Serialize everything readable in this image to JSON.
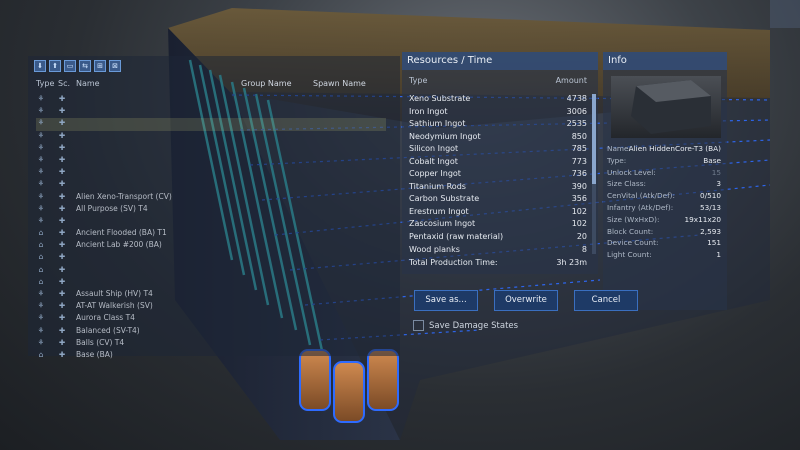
{
  "left_panel": {
    "toolbar": [
      "⬇",
      "⬆",
      "▭",
      "⇆",
      "⊞",
      "⊠"
    ],
    "headers": {
      "type": "Type",
      "sc": "Sc.",
      "name": "Name",
      "group": "Group Name",
      "spawn": "Spawn Name"
    },
    "rows": [
      {
        "type": "⚘",
        "sc": "✚",
        "name": "",
        "style": "red"
      },
      {
        "type": "⚘",
        "sc": "✚",
        "name": "",
        "style": "red"
      },
      {
        "type": "⚘",
        "sc": "✚",
        "name": "",
        "style": "sel"
      },
      {
        "type": "⚘",
        "sc": "✚",
        "name": "",
        "style": "red"
      },
      {
        "type": "⚘",
        "sc": "✚",
        "name": "",
        "style": "red"
      },
      {
        "type": "⚘",
        "sc": "✚",
        "name": "",
        "style": "red"
      },
      {
        "type": "⚘",
        "sc": "✚",
        "name": "",
        "style": "red"
      },
      {
        "type": "⚘",
        "sc": "✚",
        "name": "",
        "style": "red"
      },
      {
        "type": "⚘",
        "sc": "✚",
        "name": "Alien Xeno-Transport (CV)",
        "style": "gray"
      },
      {
        "type": "⚘",
        "sc": "✚",
        "name": "All Purpose (SV) T4",
        "style": "gray"
      },
      {
        "type": "⚘",
        "sc": "✚",
        "name": "",
        "style": "red"
      },
      {
        "type": "⌂",
        "sc": "✚",
        "name": "Ancient Flooded (BA) T1",
        "style": "gray"
      },
      {
        "type": "⌂",
        "sc": "✚",
        "name": "Ancient Lab #200 (BA)",
        "style": "gray"
      },
      {
        "type": "⌂",
        "sc": "✚",
        "name": "",
        "style": "red"
      },
      {
        "type": "⌂",
        "sc": "✚",
        "name": "",
        "style": "red"
      },
      {
        "type": "⌂",
        "sc": "✚",
        "name": "",
        "style": "red"
      },
      {
        "type": "⚘",
        "sc": "✚",
        "name": "Assault Ship (HV) T4",
        "style": "gray"
      },
      {
        "type": "⚘",
        "sc": "✚",
        "name": "AT-AT Walkerish (SV)",
        "style": "gray"
      },
      {
        "type": "⚘",
        "sc": "✚",
        "name": "Aurora Class T4",
        "style": "gray"
      },
      {
        "type": "⚘",
        "sc": "✚",
        "name": "Balanced (SV-T4)",
        "style": "gray"
      },
      {
        "type": "⚘",
        "sc": "✚",
        "name": "Balls (CV) T4",
        "style": "gray"
      },
      {
        "type": "⌂",
        "sc": "✚",
        "name": "Base (BA)",
        "style": "gray"
      }
    ]
  },
  "resources": {
    "title": "Resources / Time",
    "col_type": "Type",
    "col_amount": "Amount",
    "items": [
      {
        "name": "Xeno Substrate",
        "amount": "4738"
      },
      {
        "name": "Iron Ingot",
        "amount": "3006"
      },
      {
        "name": "Sathium Ingot",
        "amount": "2535"
      },
      {
        "name": "Neodymium Ingot",
        "amount": "850"
      },
      {
        "name": "Silicon Ingot",
        "amount": "785"
      },
      {
        "name": "Cobalt Ingot",
        "amount": "773"
      },
      {
        "name": "Copper Ingot",
        "amount": "736"
      },
      {
        "name": "Titanium Rods",
        "amount": "390"
      },
      {
        "name": "Carbon Substrate",
        "amount": "356"
      },
      {
        "name": "Erestrum Ingot",
        "amount": "102"
      },
      {
        "name": "Zascosium Ingot",
        "amount": "102"
      },
      {
        "name": "Pentaxid (raw material)",
        "amount": "20"
      },
      {
        "name": "Wood planks",
        "amount": "8"
      }
    ],
    "total_label": "Total Production Time:",
    "total_value": "3h 23m"
  },
  "info": {
    "title": "Info",
    "rows": [
      {
        "label": "Name:",
        "value": "Alien HiddenCore-T3 (BA)",
        "faint": false
      },
      {
        "label": "Type:",
        "value": "Base",
        "faint": false
      },
      {
        "label": "Unlock Level:",
        "value": "15",
        "faint": true
      },
      {
        "label": "Size Class:",
        "value": "3",
        "faint": false
      },
      {
        "label": "CenVital (Atk/Def):",
        "value": "0/510",
        "faint": false
      },
      {
        "label": "Infantry (Atk/Def):",
        "value": "53/13",
        "faint": false
      },
      {
        "label": "Size (WxHxD):",
        "value": "19x11x20",
        "faint": false
      },
      {
        "label": "Block Count:",
        "value": "2,593",
        "faint": false
      },
      {
        "label": "Device Count:",
        "value": "151",
        "faint": false
      },
      {
        "label": "Light Count:",
        "value": "1",
        "faint": false
      }
    ]
  },
  "buttons": {
    "save_as": "Save as...",
    "overwrite": "Overwrite",
    "cancel": "Cancel"
  },
  "checkbox": {
    "label": "Save Damage States"
  },
  "colors": {
    "accent": "#3a6fc0",
    "panel": "#283448",
    "red_text": "#a8353a",
    "glow": "#2e6bff",
    "cyan": "#39e0e6"
  }
}
